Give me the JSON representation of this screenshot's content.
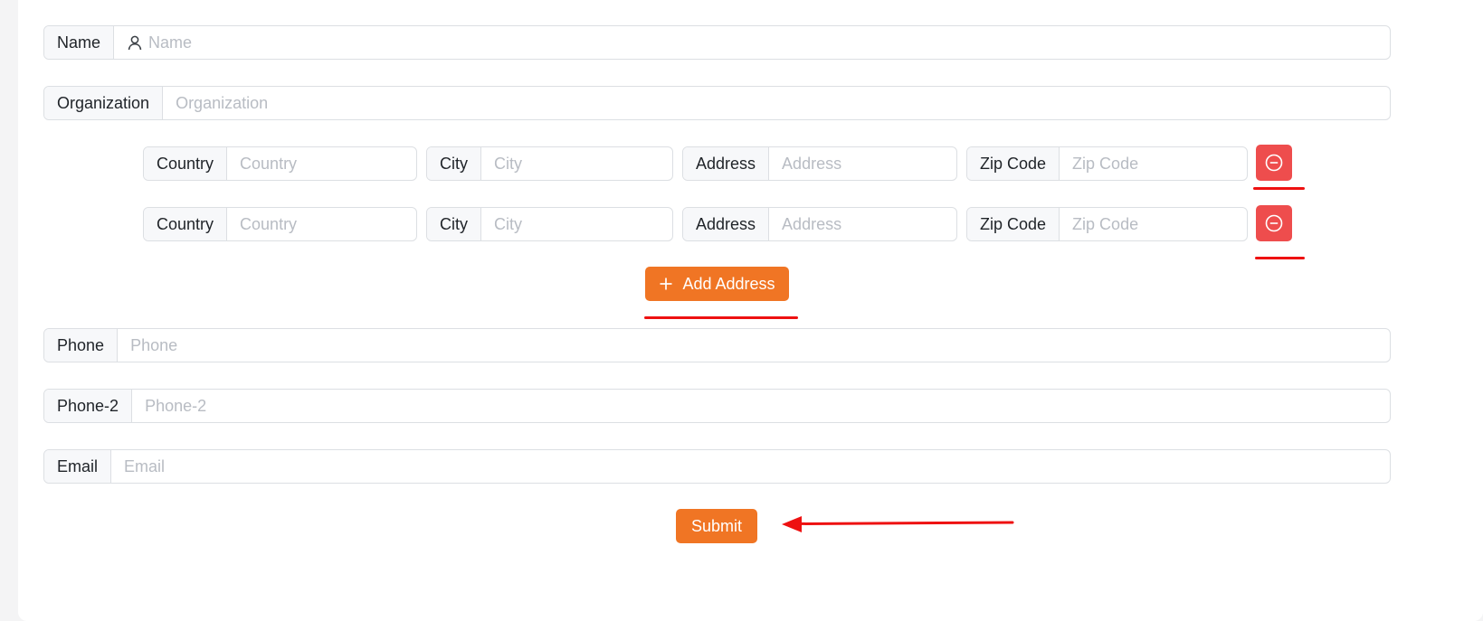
{
  "form": {
    "name": {
      "label": "Name",
      "placeholder": "Name"
    },
    "organization": {
      "label": "Organization",
      "placeholder": "Organization"
    },
    "addresses": [
      {
        "country": {
          "label": "Country",
          "placeholder": "Country"
        },
        "city": {
          "label": "City",
          "placeholder": "City"
        },
        "address": {
          "label": "Address",
          "placeholder": "Address"
        },
        "zip": {
          "label": "Zip Code",
          "placeholder": "Zip Code"
        }
      },
      {
        "country": {
          "label": "Country",
          "placeholder": "Country"
        },
        "city": {
          "label": "City",
          "placeholder": "City"
        },
        "address": {
          "label": "Address",
          "placeholder": "Address"
        },
        "zip": {
          "label": "Zip Code",
          "placeholder": "Zip Code"
        }
      }
    ],
    "add_address_label": "Add Address",
    "phone": {
      "label": "Phone",
      "placeholder": "Phone"
    },
    "phone2": {
      "label": "Phone-2",
      "placeholder": "Phone-2"
    },
    "email": {
      "label": "Email",
      "placeholder": "Email"
    },
    "submit_label": "Submit"
  },
  "icons": {
    "name_prefix": "user-icon",
    "remove": "minus-circle-icon",
    "add": "plus-icon",
    "annotation": "arrow-left-icon"
  },
  "colors": {
    "accent": "#f07524",
    "danger": "#ee4d4d",
    "annotation": "#ee1111"
  }
}
